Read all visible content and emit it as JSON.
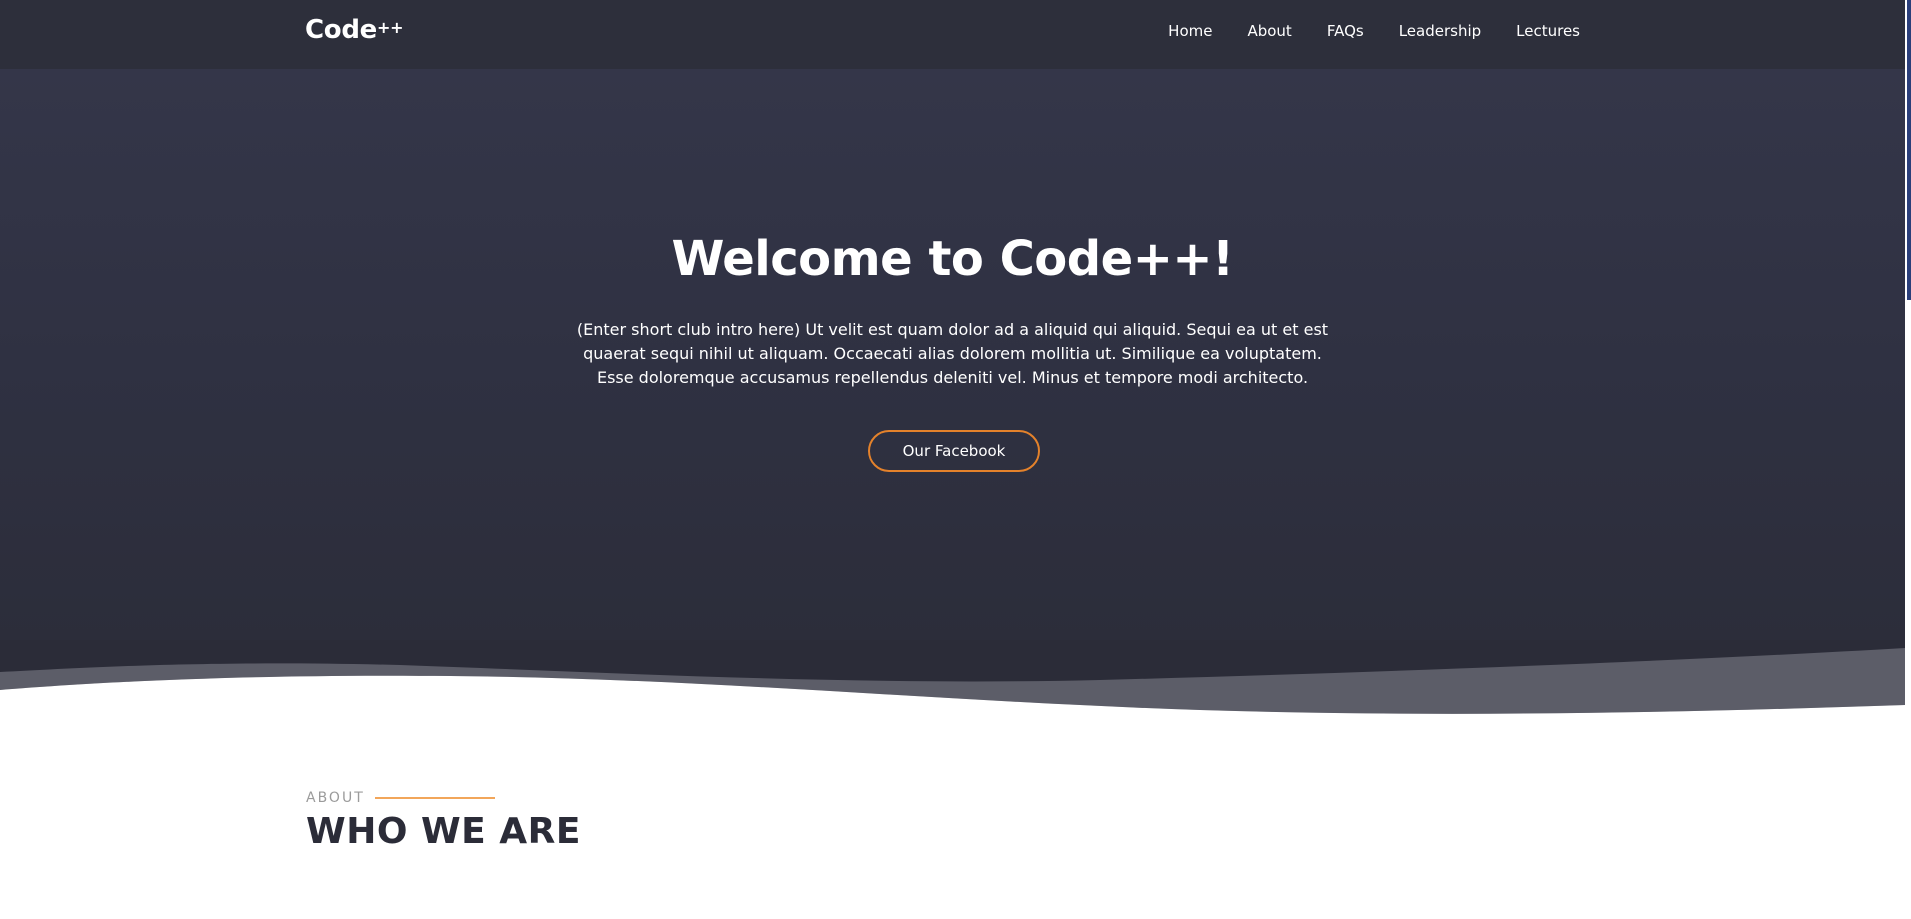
{
  "brand": {
    "name": "Code",
    "suffix": "++"
  },
  "nav": {
    "items": [
      {
        "label": "Home"
      },
      {
        "label": "About"
      },
      {
        "label": "FAQs"
      },
      {
        "label": "Leadership"
      },
      {
        "label": "Lectures"
      }
    ]
  },
  "hero": {
    "title": "Welcome to Code++!",
    "intro": "(Enter short club intro here) Ut velit est quam dolor ad a aliquid qui aliquid. Sequi ea ut et est quaerat sequi nihil ut aliquam. Occaecati alias dolorem mollitia ut. Similique ea voluptatem. Esse doloremque accusamus repellendus deleniti vel. Minus et tempore modi architecto.",
    "button_label": "Our Facebook"
  },
  "about": {
    "eyebrow": "ABOUT",
    "title": "WHO WE ARE"
  },
  "colors": {
    "nav_bg": "#2d2f3b",
    "hero_bg": "#2f3142",
    "accent": "#e4822b",
    "about_line": "#f2a65a",
    "heading_dark": "#2b2c38"
  }
}
